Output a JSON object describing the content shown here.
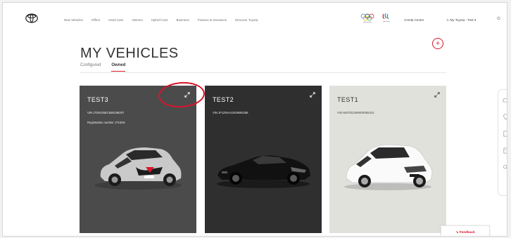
{
  "header": {
    "nav_items": [
      "New Vehicles",
      "Offers",
      "Used Cars",
      "Owners",
      "Hybrid Cars",
      "Business",
      "Finance & Insurance",
      "Discover Toyota"
    ],
    "help_label": "Help Centre",
    "account_label": "My Toyota - Test"
  },
  "page": {
    "title": "MY VEHICLES",
    "add_label": "+",
    "tabs": [
      {
        "label": "Configured",
        "active": false
      },
      {
        "label": "Owned",
        "active": true
      }
    ]
  },
  "vehicles": [
    {
      "name": "TEST3",
      "vin": "VIN JTDKGNEC50N198207",
      "registration": "Registration number JT162N",
      "body_color": "#4b4b4b",
      "car_color": "silver"
    },
    {
      "name": "TEST2",
      "vin": "VIN JF1ZNAA10G9694296",
      "registration": "",
      "body_color": "#2f2f2f",
      "car_color": "black"
    },
    {
      "name": "TEST1",
      "vin": "VIN NMTDD26R80R068422",
      "registration": "",
      "body_color": "#e1e1dc",
      "car_color": "white"
    }
  ],
  "feedback": {
    "label": "Feedback"
  },
  "colors": {
    "accent": "#d9142b"
  }
}
